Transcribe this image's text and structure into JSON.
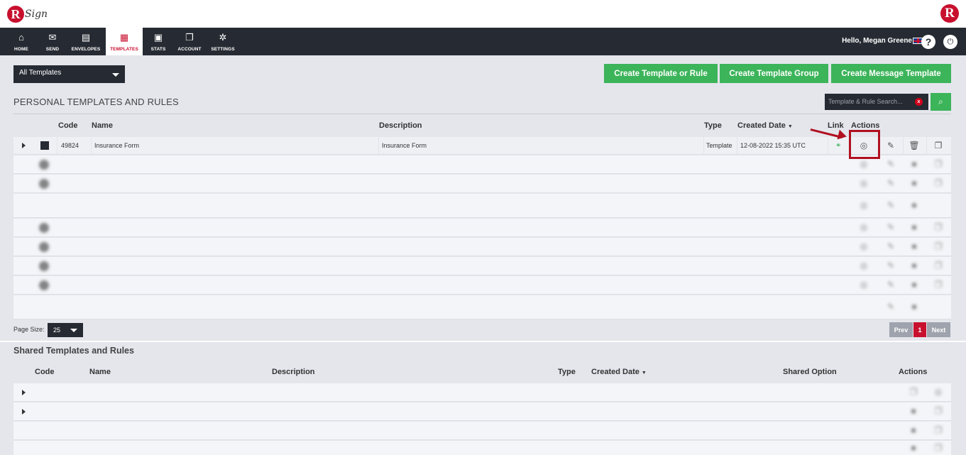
{
  "header": {
    "logo_text": "Sign",
    "logo_letter": "R",
    "right_logo_letter": "R"
  },
  "nav": {
    "items": [
      {
        "label": "HOME",
        "icon": "home-icon"
      },
      {
        "label": "SEND",
        "icon": "envelope-icon"
      },
      {
        "label": "ENVELOPES",
        "icon": "inbox-icon"
      },
      {
        "label": "TEMPLATES",
        "icon": "template-icon",
        "active": true
      },
      {
        "label": "STATS",
        "icon": "briefcase-icon"
      },
      {
        "label": "ACCOUNT",
        "icon": "copy-icon"
      },
      {
        "label": "SETTINGS",
        "icon": "gear-icon"
      }
    ],
    "greeting": "Hello, Megan Greene",
    "help_symbol": "?",
    "power_symbol": "⏻"
  },
  "toolbar": {
    "filter_value": "All Templates",
    "create_template_label": "Create Template or Rule",
    "create_group_label": "Create Template Group",
    "create_message_label": "Create Message Template"
  },
  "personal": {
    "title": "PERSONAL TEMPLATES AND RULES",
    "search_placeholder": "Template & Rule Search...",
    "search_clear": "x",
    "columns": {
      "code": "Code",
      "name": "Name",
      "description": "Description",
      "type": "Type",
      "created": "Created Date",
      "link": "Link",
      "actions": "Actions"
    },
    "first_row": {
      "code": "49824",
      "name": "Insurance Form",
      "description": "Insurance Form",
      "type": "Template",
      "created": "12-08-2022 15:35 UTC"
    },
    "page_size_label": "Page Size:",
    "page_size_value": "25",
    "pagination": {
      "prev": "Prev",
      "current": "1",
      "next": "Next"
    }
  },
  "shared": {
    "title": "Shared Templates and Rules",
    "columns": {
      "code": "Code",
      "name": "Name",
      "description": "Description",
      "type": "Type",
      "created": "Created Date",
      "shared_option": "Shared Option",
      "actions": "Actions"
    }
  },
  "colors": {
    "brand_red": "#c8102e",
    "green": "#3cb45a",
    "dark": "#262b33",
    "highlight": "#b01020"
  }
}
